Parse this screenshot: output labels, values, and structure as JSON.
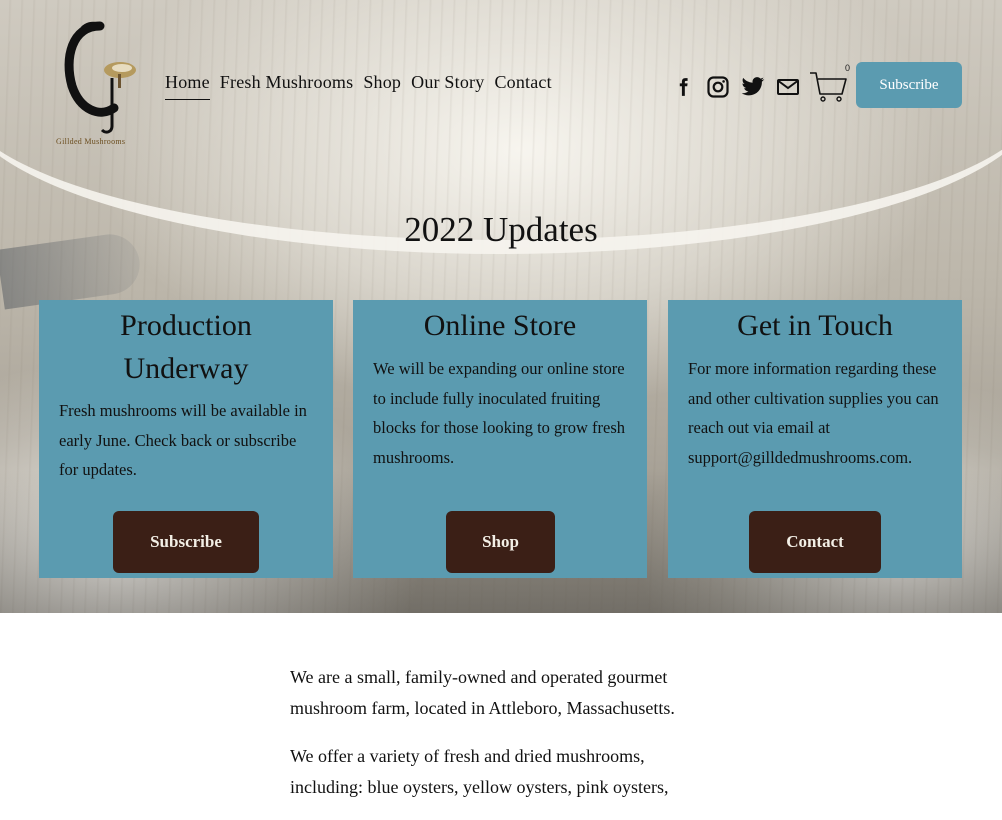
{
  "site": {
    "logo_text": "Gillded Mushrooms"
  },
  "nav": {
    "items": [
      {
        "label": "Home",
        "active": true
      },
      {
        "label": "Fresh Mushrooms"
      },
      {
        "label": "Shop"
      },
      {
        "label": "Our Story"
      },
      {
        "label": "Contact"
      }
    ]
  },
  "header": {
    "social_icons": [
      "facebook-icon",
      "instagram-icon",
      "twitter-icon",
      "email-icon"
    ],
    "cart_count": "0",
    "subscribe_label": "Subscribe"
  },
  "hero": {
    "title": "2022 Updates"
  },
  "cards": [
    {
      "title_line1": "Production",
      "title_line2": "Underway",
      "body": "Fresh mushrooms will be available in early June. Check back or subscribe for updates.",
      "button": "Subscribe"
    },
    {
      "title_line1": "Online Store",
      "body": "We will be expanding our online store to include fully inoculated fruiting blocks for those looking to grow fresh mushrooms.",
      "button": "Shop"
    },
    {
      "title_line1": "Get in Touch",
      "body": "For more information regarding these and other cultivation supplies you can reach out via email at support@gilldedmushrooms.com.",
      "button": "Contact"
    }
  ],
  "about": {
    "p1": "We are a small, family-owned and operated gourmet mushroom farm, located in Attleboro, Massachusetts.",
    "p2": "We offer a variety of fresh and dried mushrooms, including: blue oysters, yellow oysters, pink oysters,"
  },
  "colors": {
    "card_bg": "#5b9bb0",
    "button_dark": "#3b1f16",
    "header_button": "#5b9bb0"
  }
}
